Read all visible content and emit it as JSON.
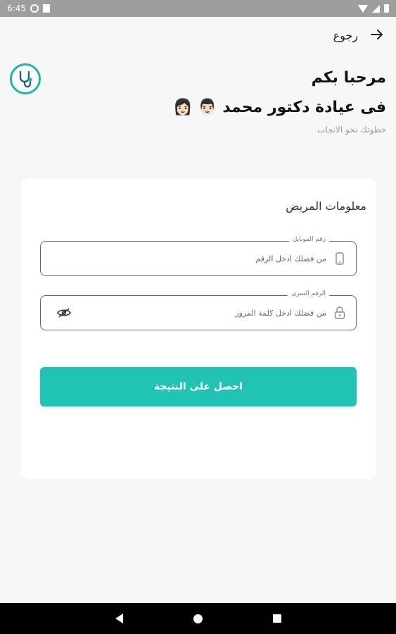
{
  "status_bar": {
    "time": "6:45"
  },
  "header": {
    "back_label": "رجوع",
    "back_icon": "arrow-right-icon"
  },
  "welcome": {
    "line1": "مرحبا بكم",
    "line2": "فى عيادة دكتور محمد 👨🏻 👩🏻",
    "tagline": "خطوتك نحو الانجاب"
  },
  "form": {
    "title": "معلومات المريض",
    "phone": {
      "label": "رقم الموبايل",
      "placeholder": "من فضلك ادخل الرقم",
      "value": "",
      "icon": "smartphone-icon"
    },
    "password": {
      "label": "الرقم السرى",
      "placeholder": "من فضلك ادخل كلمة المرور",
      "value": "",
      "icon": "lock-icon",
      "toggle_icon": "eye-off-icon"
    },
    "submit_label": "احصل على النتيجة"
  },
  "colors": {
    "accent": "#21c4b4",
    "background": "#f7f7f7",
    "card": "#ffffff",
    "status_bar": "#9e9e9e"
  }
}
